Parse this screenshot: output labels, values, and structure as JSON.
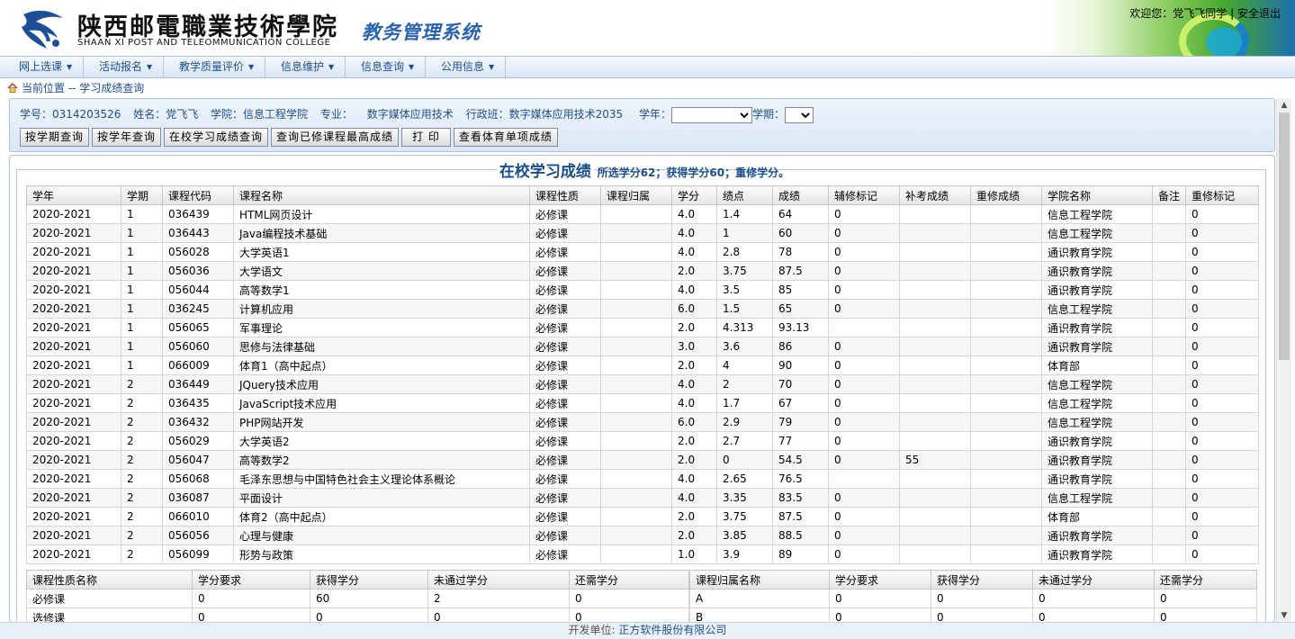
{
  "header": {
    "school_name_cn": "陕西邮電職業技術學院",
    "school_name_en": "SHAAN XI POST AND TELEOMMUNICATION COLLEGE",
    "system_title": "教务管理系统",
    "welcome": "欢迎您：党飞飞同学",
    "separator": "|",
    "logout": "安全退出"
  },
  "menu": [
    {
      "label": "网上选课"
    },
    {
      "label": "活动报名"
    },
    {
      "label": "教学质量评价"
    },
    {
      "label": "信息维护"
    },
    {
      "label": "信息查询"
    },
    {
      "label": "公用信息"
    }
  ],
  "breadcrumb": "当前位置 -- 学习成绩查询",
  "student": {
    "id_label": "学号：0314203526",
    "name_label": "姓名：党飞飞",
    "college_label": "学院：信息工程学院",
    "major_key": "专业：",
    "major_value": "数字媒体应用技术",
    "class_label": "行政班：数字媒体应用技术2035",
    "year_label": "学年：",
    "year_value": "",
    "term_label": "学期：",
    "term_value": ""
  },
  "buttons": [
    {
      "label": "按学期查询"
    },
    {
      "label": "按学年查询"
    },
    {
      "label": "在校学习成绩查询"
    },
    {
      "label": "查询已修课程最高成绩"
    },
    {
      "label": "打 印"
    },
    {
      "label": "查看体育单项成绩"
    }
  ],
  "report": {
    "title": "在校学习成绩",
    "summary": "所选学分62；获得学分60；重修学分。"
  },
  "grades": {
    "columns": [
      "学年",
      "学期",
      "课程代码",
      "课程名称",
      "课程性质",
      "课程归属",
      "学分",
      "绩点",
      "成绩",
      "辅修标记",
      "补考成绩",
      "重修成绩",
      "学院名称",
      "备注",
      "重修标记"
    ],
    "rows": [
      [
        "2020-2021",
        "1",
        "036439",
        "HTML网页设计",
        "必修课",
        "",
        "4.0",
        "1.4",
        "64",
        "0",
        "",
        "",
        "信息工程学院",
        "",
        "0"
      ],
      [
        "2020-2021",
        "1",
        "036443",
        "Java编程技术基础",
        "必修课",
        "",
        "4.0",
        "1",
        "60",
        "0",
        "",
        "",
        "信息工程学院",
        "",
        "0"
      ],
      [
        "2020-2021",
        "1",
        "056028",
        "大学英语1",
        "必修课",
        "",
        "4.0",
        "2.8",
        "78",
        "0",
        "",
        "",
        "通识教育学院",
        "",
        "0"
      ],
      [
        "2020-2021",
        "1",
        "056036",
        "大学语文",
        "必修课",
        "",
        "2.0",
        "3.75",
        "87.5",
        "0",
        "",
        "",
        "通识教育学院",
        "",
        "0"
      ],
      [
        "2020-2021",
        "1",
        "056044",
        "高等数学1",
        "必修课",
        "",
        "4.0",
        "3.5",
        "85",
        "0",
        "",
        "",
        "通识教育学院",
        "",
        "0"
      ],
      [
        "2020-2021",
        "1",
        "036245",
        "计算机应用",
        "必修课",
        "",
        "6.0",
        "1.5",
        "65",
        "0",
        "",
        "",
        "信息工程学院",
        "",
        "0"
      ],
      [
        "2020-2021",
        "1",
        "056065",
        "军事理论",
        "必修课",
        "",
        "2.0",
        "4.313",
        "93.13",
        "",
        "",
        "",
        "通识教育学院",
        "",
        "0"
      ],
      [
        "2020-2021",
        "1",
        "056060",
        "思修与法律基础",
        "必修课",
        "",
        "3.0",
        "3.6",
        "86",
        "0",
        "",
        "",
        "通识教育学院",
        "",
        "0"
      ],
      [
        "2020-2021",
        "1",
        "066009",
        "体育1（高中起点）",
        "必修课",
        "",
        "2.0",
        "4",
        "90",
        "0",
        "",
        "",
        "体育部",
        "",
        "0"
      ],
      [
        "2020-2021",
        "2",
        "036449",
        "JQuery技术应用",
        "必修课",
        "",
        "4.0",
        "2",
        "70",
        "0",
        "",
        "",
        "信息工程学院",
        "",
        "0"
      ],
      [
        "2020-2021",
        "2",
        "036435",
        "JavaScript技术应用",
        "必修课",
        "",
        "4.0",
        "1.7",
        "67",
        "0",
        "",
        "",
        "信息工程学院",
        "",
        "0"
      ],
      [
        "2020-2021",
        "2",
        "036432",
        "PHP网站开发",
        "必修课",
        "",
        "6.0",
        "2.9",
        "79",
        "0",
        "",
        "",
        "信息工程学院",
        "",
        "0"
      ],
      [
        "2020-2021",
        "2",
        "056029",
        "大学英语2",
        "必修课",
        "",
        "2.0",
        "2.7",
        "77",
        "0",
        "",
        "",
        "通识教育学院",
        "",
        "0"
      ],
      [
        "2020-2021",
        "2",
        "056047",
        "高等数学2",
        "必修课",
        "",
        "2.0",
        "0",
        "54.5",
        "0",
        "55",
        "",
        "通识教育学院",
        "",
        "0"
      ],
      [
        "2020-2021",
        "2",
        "056068",
        "毛泽东思想与中国特色社会主义理论体系概论",
        "必修课",
        "",
        "4.0",
        "2.65",
        "76.5",
        "",
        "",
        "",
        "通识教育学院",
        "",
        "0"
      ],
      [
        "2020-2021",
        "2",
        "036087",
        "平面设计",
        "必修课",
        "",
        "4.0",
        "3.35",
        "83.5",
        "0",
        "",
        "",
        "信息工程学院",
        "",
        "0"
      ],
      [
        "2020-2021",
        "2",
        "066010",
        "体育2（高中起点）",
        "必修课",
        "",
        "2.0",
        "3.75",
        "87.5",
        "0",
        "",
        "",
        "体育部",
        "",
        "0"
      ],
      [
        "2020-2021",
        "2",
        "056056",
        "心理与健康",
        "必修课",
        "",
        "2.0",
        "3.85",
        "88.5",
        "0",
        "",
        "",
        "通识教育学院",
        "",
        "0"
      ],
      [
        "2020-2021",
        "2",
        "056099",
        "形势与政策",
        "必修课",
        "",
        "1.0",
        "3.9",
        "89",
        "0",
        "",
        "",
        "通识教育学院",
        "",
        "0"
      ]
    ]
  },
  "summary_nature": {
    "columns": [
      "课程性质名称",
      "学分要求",
      "获得学分",
      "未通过学分",
      "还需学分"
    ],
    "rows": [
      [
        "必修课",
        "0",
        "60",
        "2",
        "0"
      ],
      [
        "选修课",
        "0",
        "0",
        "0",
        "0"
      ]
    ]
  },
  "summary_belong": {
    "columns": [
      "课程归属名称",
      "学分要求",
      "获得学分",
      "未通过学分",
      "还需学分"
    ],
    "rows": [
      [
        "A",
        "0",
        "0",
        "0",
        "0"
      ],
      [
        "B",
        "0",
        "0",
        "0",
        "0"
      ]
    ]
  },
  "footer": {
    "label": "开发单位:",
    "company": "正方软件股份有限公司"
  },
  "icons": {
    "home": "home-icon",
    "caret": "caret-down-icon",
    "scroll_up": "scroll-up-arrow-icon",
    "scroll_down": "scroll-down-arrow-icon"
  },
  "colors": {
    "menu_text": "#1f4f8f",
    "title_blue": "#1a4d8c",
    "system_title": "#2a62ad"
  }
}
